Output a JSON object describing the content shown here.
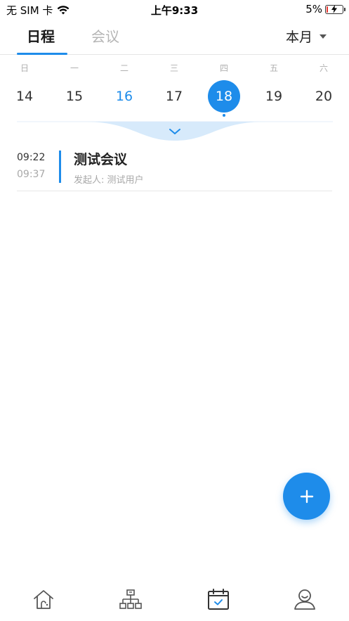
{
  "status_bar": {
    "carrier": "无 SIM 卡",
    "time": "上午9:33",
    "battery_percent": "5%",
    "battery_level": 0.05
  },
  "header": {
    "tabs": [
      {
        "label": "日程",
        "active": true
      },
      {
        "label": "会议",
        "active": false
      }
    ],
    "month_select": "本月"
  },
  "week": {
    "weekdays": [
      "日",
      "一",
      "二",
      "三",
      "四",
      "五",
      "六"
    ],
    "dates": [
      "14",
      "15",
      "16",
      "17",
      "18",
      "19",
      "20"
    ],
    "today_index": 2,
    "selected_index": 4
  },
  "events": [
    {
      "start": "09:22",
      "end": "09:37",
      "title": "测试会议",
      "subtitle": "发起人: 测试用户"
    }
  ],
  "fab": {
    "icon": "plus-icon"
  },
  "bottom_nav": [
    {
      "icon": "home-icon",
      "active": false
    },
    {
      "icon": "org-chart-icon",
      "active": false
    },
    {
      "icon": "calendar-icon",
      "active": true
    },
    {
      "icon": "user-icon",
      "active": false
    }
  ],
  "colors": {
    "accent": "#1e8cea",
    "muted": "#b0b0b0",
    "text": "#222222"
  }
}
